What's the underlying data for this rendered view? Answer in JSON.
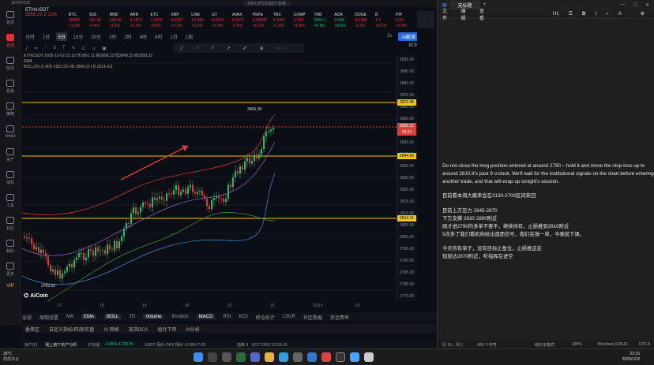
{
  "window": {
    "title": "1875/7023",
    "chart_title": "OKX BTC/USDT 永续"
  },
  "sidebar": [
    {
      "label": "首页"
    },
    {
      "label": "自选",
      "active": true
    },
    {
      "label": "快讯"
    },
    {
      "label": "看板"
    },
    {
      "label": "策略"
    },
    {
      "label": "Web3"
    },
    {
      "label": "资产"
    },
    {
      "label": "指标"
    },
    {
      "label": "工具"
    },
    {
      "label": "社区"
    },
    {
      "label": "我的"
    },
    {
      "label": "更多"
    }
  ],
  "sidebar_bottom": {
    "vip": "VIP"
  },
  "price_header": {
    "symbol": "ETH/USDT",
    "price": "2858.22",
    "change": "2.12%"
  },
  "tickers": [
    {
      "name": "BTC",
      "price": "99566",
      "chg": "+1.2%",
      "up": false
    },
    {
      "name": "SOL",
      "price": "131.02",
      "chg": "-0.4%",
      "up": false
    },
    {
      "name": "BNB",
      "price": "640.45",
      "chg": "-0.3%",
      "up": false
    },
    {
      "name": "ARB",
      "price": "0.1971",
      "chg": "+1.0%",
      "up": false
    },
    {
      "name": "ETC",
      "price": "1.4160",
      "chg": "-0.8%",
      "up": false
    },
    {
      "name": "XRP",
      "price": "0.0037",
      "chg": "+0.3%",
      "up": false
    },
    {
      "name": "LINK",
      "price": "12.438",
      "chg": "+0.2%",
      "up": false
    },
    {
      "name": "GT",
      "price": "0.0013",
      "chg": "+0.4%",
      "up": false
    },
    {
      "name": "AVAX",
      "price": "0.3271",
      "chg": "-0.5%",
      "up": false
    },
    {
      "name": "PEPE",
      "price": "0.00000",
      "chg": "+0.1%",
      "up": false
    },
    {
      "name": "TRX",
      "price": "0.4947",
      "chg": "+1.0%",
      "up": false
    },
    {
      "name": "COMP",
      "price": "3.329",
      "chg": "+0.4%",
      "up": false
    },
    {
      "name": "TRB",
      "price": "2856.1",
      "chg": "+0.9%",
      "up": true
    },
    {
      "name": "ADA",
      "price": "0.000",
      "chg": "+0.6%",
      "up": true
    },
    {
      "name": "DOGE",
      "price": "0.1384",
      "chg": "-0.2%",
      "up": false
    },
    {
      "name": "B",
      "price": "1.3",
      "chg": "+0.1%",
      "up": false
    },
    {
      "name": "PIP",
      "price": "0.90",
      "chg": "+0.2%",
      "up": false
    }
  ],
  "timeframes": [
    "分时",
    "1分",
    "5分",
    "15分",
    "30分",
    "1时",
    "2时",
    "4时",
    "6时",
    "1日",
    "1周"
  ],
  "active_tf": "5分",
  "chart_tools": {
    "candle": "2s",
    "ai": "AI解读",
    "bo": "BOK"
  },
  "indicators": {
    "line1": "ETH/USDT 2025-12-02 22:15  开2851.11 高2858.13 低2849.25 收2858.22",
    "line2": "EMA",
    "line3": "BOLL(20,2)  MID 2831.50  UB 2866.61  LB 2814.911"
  },
  "price_axis": [
    "2895.00",
    "2890.00",
    "2880.00",
    "2875.00",
    "2865.00",
    "2860.00",
    "2850.00",
    "2845.00",
    "2840.00",
    "2835.00",
    "2830.00",
    "2825.00",
    "2815.00",
    "2810.00",
    "2805.00",
    "2800.00",
    "2795.00",
    "2790.00",
    "2785.00",
    "2780.00",
    "2775.00"
  ],
  "levels": {
    "top": "2870.45",
    "mid": "2844.66",
    "low": "2814.11",
    "current": "2858.22",
    "countdown": "03:53",
    "peak": "2866.28",
    "bottom": "2783.50"
  },
  "date_axis": [
    "17",
    "18",
    "19",
    "20",
    "21",
    "22",
    "12/13",
    "01"
  ],
  "logo": "AiCoin",
  "bottom_tabs": [
    "全部",
    "周期设置",
    "",
    "MA",
    "EMA",
    "BOLL",
    "TD",
    "",
    "Volume",
    "Position",
    "MACD",
    "RSI",
    "KDJ",
    "修仓统计",
    "LSUR",
    "社区数据",
    "资金费率"
  ],
  "bottom_bar": [
    "委单区",
    "自定义指标/回测/实盘",
    "AI 网格",
    "现货DCA",
    "组合下单",
    "AI分析"
  ],
  "status_bar": {
    "left": "资产(F)",
    "l2": "我上链下资产分析",
    "l3": "价加值",
    "l4": "-0.88%  4,223.86",
    "l5": "USDT 场外-OKX  相对 -0.28%  7.05",
    "right": "指数 3 · SGT 12/02 22:16:10"
  },
  "notepad": {
    "title": "无标题",
    "menu": [
      "文件",
      "编辑",
      "查看"
    ],
    "toolbar": {
      "heading": "H1",
      "b": "B",
      "i": "I",
      "clear": "A"
    },
    "body": [
      "Do not close the long position entered at around 2790 – hold it and move the stop-loss up to around 2810.It's past 9 o'clock. We'll wait for the institutional signals on the chart before entering another trade, and that will wrap up tonight's session.",
      "",
      "目前看本周大概率会在3130-2700区间来回",
      "",
      "目前上方压力    2845-2870",
      "下方支撑    2830    2890附近",
      "刚才进2790的多单不要平，继续持有，止损推到2810附近",
      "9点多了我们看机构给出盘面信号，我们在做一单，今晚就下课。",
      "",
      "今天所有单子，没有目标止盈位，止损推这走",
      "短到达2870附近，听指挥在进空"
    ],
    "status": {
      "pos": "行 15，列 1",
      "chars": "435 个字符",
      "format": "纯文本格式",
      "zoom": "100%",
      "eol": "Windows (CRLF)",
      "enc": "UTF-8"
    }
  },
  "taskbar": {
    "weather": "28°C",
    "weather2": "局部多云",
    "time": "22:16",
    "date": "2025/12/2"
  }
}
